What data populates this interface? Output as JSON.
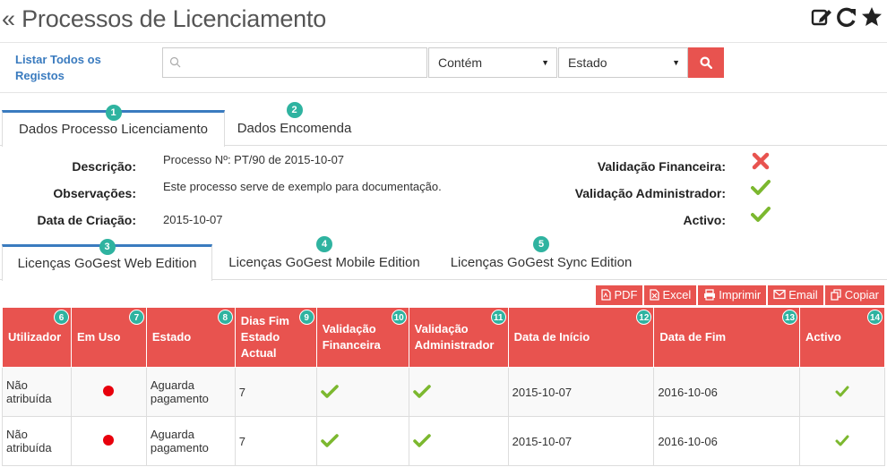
{
  "header": {
    "title": "« Processos de Licenciamento",
    "tools": [
      {
        "icon": "edit-icon"
      },
      {
        "icon": "refresh-icon"
      },
      {
        "icon": "star-icon"
      }
    ]
  },
  "filter": {
    "list_all_label": "Listar Todos os Registos",
    "search_value": "",
    "search_placeholder": "",
    "contains_selected": "Contém",
    "state_selected": "Estado",
    "search_button_icon": "search-icon"
  },
  "tabs_main": [
    {
      "step": "1",
      "label": "Dados Processo Licenciamento",
      "active": true
    },
    {
      "step": "2",
      "label": "Dados Encomenda",
      "active": false
    }
  ],
  "details": {
    "description_label": "Descrição:",
    "description_value": "Processo Nº: PT/90 de 2015-10-07",
    "observations_label": "Observações:",
    "observations_value": "Este processo serve de exemplo para documentação.",
    "created_label": "Data de Criação:",
    "created_value": "2015-10-07",
    "fin_validation_label": "Validação Financeira:",
    "fin_validation_value": "no",
    "admin_validation_label": "Validação Administrador:",
    "admin_validation_value": "yes",
    "active_label": "Activo:",
    "active_value": "yes"
  },
  "tabs_licenses": [
    {
      "step": "3",
      "label": "Licenças GoGest Web Edition",
      "active": true
    },
    {
      "step": "4",
      "label": "Licenças GoGest Mobile Edition",
      "active": false
    },
    {
      "step": "5",
      "label": "Licenças GoGest Sync Edition",
      "active": false
    }
  ],
  "export_buttons": [
    {
      "label": "PDF",
      "icon": "pdf-icon"
    },
    {
      "label": "Excel",
      "icon": "excel-icon"
    },
    {
      "label": "Imprimir",
      "icon": "print-icon"
    },
    {
      "label": "Email",
      "icon": "email-icon"
    },
    {
      "label": "Copiar",
      "icon": "copy-icon"
    }
  ],
  "table": {
    "columns": [
      {
        "step": "6",
        "label": "Utilizador"
      },
      {
        "step": "7",
        "label": "Em Uso"
      },
      {
        "step": "8",
        "label": "Estado"
      },
      {
        "step": "9",
        "label": "Dias Fim Estado Actual"
      },
      {
        "step": "10",
        "label": "Validação Financeira"
      },
      {
        "step": "11",
        "label": "Validação Administrador"
      },
      {
        "step": "12",
        "label": "Data de Início"
      },
      {
        "step": "13",
        "label": "Data de Fim"
      },
      {
        "step": "14",
        "label": "Activo"
      }
    ],
    "rows": [
      {
        "user": "Não atribuída",
        "in_use": "red-dot",
        "state": "Aguarda pagamento",
        "days": "7",
        "fin": "yes",
        "admin": "yes",
        "start": "2015-10-07",
        "end": "2016-10-06",
        "active": "yes"
      },
      {
        "user": "Não atribuída",
        "in_use": "red-dot",
        "state": "Aguarda pagamento",
        "days": "7",
        "fin": "yes",
        "admin": "yes",
        "start": "2015-10-07",
        "end": "2016-10-06",
        "active": "yes"
      }
    ]
  },
  "colors": {
    "accent_red": "#e8534f",
    "link_blue": "#3a7bbf",
    "badge_teal": "#2fb3a0",
    "check_green": "#7cb82f",
    "cross_red": "#e8534f"
  }
}
